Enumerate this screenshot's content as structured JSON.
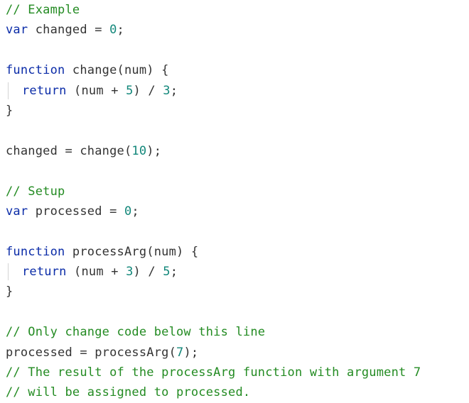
{
  "colors": {
    "comment": "#238b22",
    "keyword": "#0b2ca8",
    "number": "#12877a",
    "text": "#333333",
    "indent_guide": "#d4d4d4",
    "background": "#ffffff"
  },
  "code": {
    "lines": [
      {
        "indent": false,
        "tokens": [
          {
            "t": "comment",
            "v": "// Example"
          }
        ]
      },
      {
        "indent": false,
        "tokens": [
          {
            "t": "keyword",
            "v": "var"
          },
          {
            "t": "ident",
            "v": " changed = "
          },
          {
            "t": "number",
            "v": "0"
          },
          {
            "t": "punc",
            "v": ";"
          }
        ]
      },
      {
        "indent": false,
        "tokens": []
      },
      {
        "indent": false,
        "tokens": [
          {
            "t": "keyword",
            "v": "function"
          },
          {
            "t": "ident",
            "v": " change(num) {"
          }
        ]
      },
      {
        "indent": true,
        "tokens": [
          {
            "t": "keyword",
            "v": "return"
          },
          {
            "t": "ident",
            "v": " (num + "
          },
          {
            "t": "number",
            "v": "5"
          },
          {
            "t": "ident",
            "v": ") / "
          },
          {
            "t": "number",
            "v": "3"
          },
          {
            "t": "punc",
            "v": ";"
          }
        ]
      },
      {
        "indent": false,
        "tokens": [
          {
            "t": "punc",
            "v": "}"
          }
        ]
      },
      {
        "indent": false,
        "tokens": []
      },
      {
        "indent": false,
        "tokens": [
          {
            "t": "ident",
            "v": "changed = change("
          },
          {
            "t": "number",
            "v": "10"
          },
          {
            "t": "punc",
            "v": ");"
          }
        ]
      },
      {
        "indent": false,
        "tokens": []
      },
      {
        "indent": false,
        "tokens": [
          {
            "t": "comment",
            "v": "// Setup"
          }
        ]
      },
      {
        "indent": false,
        "tokens": [
          {
            "t": "keyword",
            "v": "var"
          },
          {
            "t": "ident",
            "v": " processed = "
          },
          {
            "t": "number",
            "v": "0"
          },
          {
            "t": "punc",
            "v": ";"
          }
        ]
      },
      {
        "indent": false,
        "tokens": []
      },
      {
        "indent": false,
        "tokens": [
          {
            "t": "keyword",
            "v": "function"
          },
          {
            "t": "ident",
            "v": " processArg(num) {"
          }
        ]
      },
      {
        "indent": true,
        "tokens": [
          {
            "t": "keyword",
            "v": "return"
          },
          {
            "t": "ident",
            "v": " (num + "
          },
          {
            "t": "number",
            "v": "3"
          },
          {
            "t": "ident",
            "v": ") / "
          },
          {
            "t": "number",
            "v": "5"
          },
          {
            "t": "punc",
            "v": ";"
          }
        ]
      },
      {
        "indent": false,
        "tokens": [
          {
            "t": "punc",
            "v": "}"
          }
        ]
      },
      {
        "indent": false,
        "tokens": []
      },
      {
        "indent": false,
        "tokens": [
          {
            "t": "comment",
            "v": "// Only change code below this line"
          }
        ]
      },
      {
        "indent": false,
        "tokens": [
          {
            "t": "ident",
            "v": "processed = processArg("
          },
          {
            "t": "number",
            "v": "7"
          },
          {
            "t": "punc",
            "v": ");"
          }
        ]
      },
      {
        "indent": false,
        "tokens": [
          {
            "t": "comment",
            "v": "// The result of the processArg function with argument 7"
          }
        ]
      },
      {
        "indent": false,
        "tokens": [
          {
            "t": "comment",
            "v": "// will be assigned to processed."
          }
        ]
      }
    ]
  }
}
